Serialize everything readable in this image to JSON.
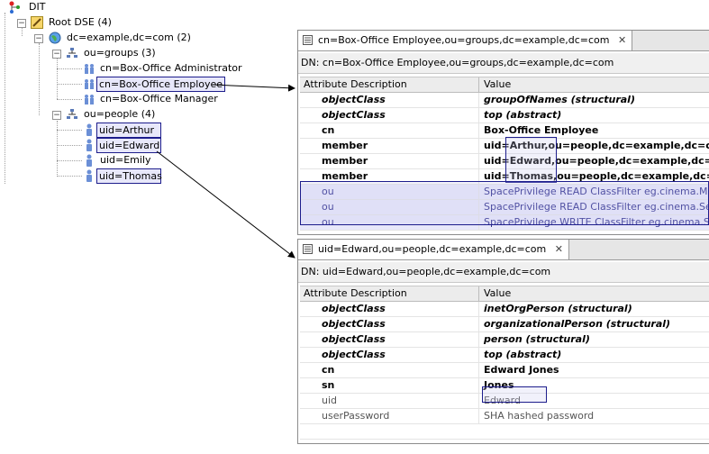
{
  "tree": {
    "root": "DIT",
    "dse": "Root DSE (4)",
    "base": "dc=example,dc=com (2)",
    "groups": "ou=groups (3)",
    "group_items": [
      "cn=Box-Office Administrator",
      "cn=Box-Office Employee",
      "cn=Box-Office Manager"
    ],
    "people": "ou=people (4)",
    "people_items": [
      "uid=Arthur",
      "uid=Edward",
      "uid=Emily",
      "uid=Thomas"
    ]
  },
  "editor_top": {
    "tab_title": "cn=Box-Office Employee,ou=groups,dc=example,dc=com",
    "dn": "DN: cn=Box-Office Employee,ou=groups,dc=example,dc=com",
    "col_attr": "Attribute Description",
    "col_value": "Value",
    "rows": [
      {
        "attr": "objectClass",
        "value": "groupOfNames (structural)"
      },
      {
        "attr": "objectClass",
        "value": "top (abstract)"
      },
      {
        "attr": "cn",
        "value": "Box-Office Employee"
      },
      {
        "attr": "member",
        "value": "uid=Arthur,ou=people,dc=example,dc=com"
      },
      {
        "attr": "member",
        "value": "uid=Edward,ou=people,dc=example,dc=com"
      },
      {
        "attr": "member",
        "value": "uid=Thomas,ou=people,dc=example,dc=com"
      },
      {
        "attr": "ou",
        "value": "SpacePrivilege READ ClassFilter eg.cinema.Movie"
      },
      {
        "attr": "ou",
        "value": "SpacePrivilege READ ClassFilter eg.cinema.Seat"
      },
      {
        "attr": "ou",
        "value": "SpacePrivilege WRITE ClassFilter eg.cinema.Seat"
      }
    ]
  },
  "editor_bottom": {
    "tab_title": "uid=Edward,ou=people,dc=example,dc=com",
    "dn": "DN: uid=Edward,ou=people,dc=example,dc=com",
    "col_attr": "Attribute Description",
    "col_value": "Value",
    "rows": [
      {
        "attr": "objectClass",
        "value": "inetOrgPerson (structural)"
      },
      {
        "attr": "objectClass",
        "value": "organizationalPerson (structural)"
      },
      {
        "attr": "objectClass",
        "value": "person (structural)"
      },
      {
        "attr": "objectClass",
        "value": "top (abstract)"
      },
      {
        "attr": "cn",
        "value": "Edward Jones"
      },
      {
        "attr": "sn",
        "value": "Jones"
      },
      {
        "attr": "uid",
        "value": "Edward"
      },
      {
        "attr": "userPassword",
        "value": "SHA hashed password"
      }
    ]
  },
  "colors": {
    "highlight_border": "#1d1d8c",
    "highlight_fill": "#e8e8fa"
  }
}
